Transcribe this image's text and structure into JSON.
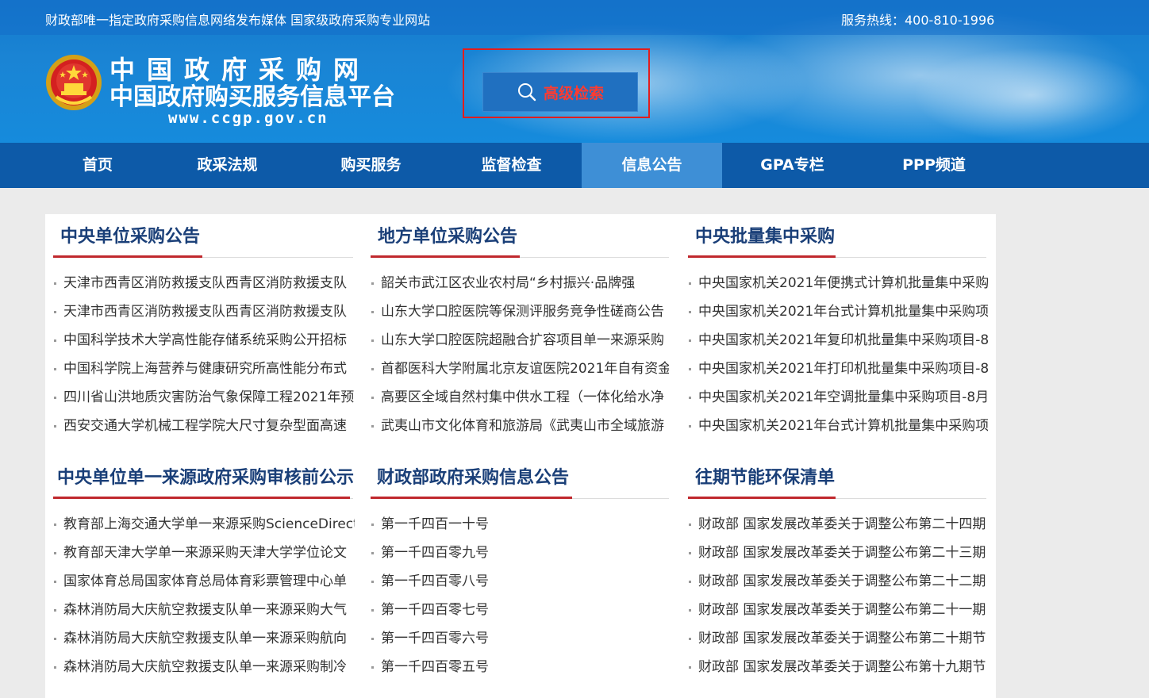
{
  "header": {
    "slogan": "财政部唯一指定政府采购信息网络发布媒体 国家级政府采购专业网站",
    "hotline": "服务热线：400-810-1996",
    "logo_line1": "中国政府采购网",
    "logo_line2": "中国政府购买服务信息平台",
    "logo_url": "www.ccgp.gov.cn",
    "search_label": "高级检索",
    "search_icon": "search-icon",
    "emblem_icon": "national-emblem-icon"
  },
  "nav": {
    "items": [
      "首页",
      "政采法规",
      "购买服务",
      "监督检查",
      "信息公告",
      "GPA专栏",
      "PPP频道"
    ],
    "active": "信息公告"
  },
  "colors": {
    "header_blue": "#1a84d4",
    "nav_blue": "#0d5aa8",
    "nav_active": "#3e8fd6",
    "title_navy": "#1a3f78",
    "accent_red": "#c0282d",
    "search_red": "#ff3b30"
  },
  "sections": [
    {
      "title": "中央单位采购公告",
      "items": [
        "天津市西青区消防救援支队西青区消防救援支队",
        "天津市西青区消防救援支队西青区消防救援支队",
        "中国科学技术大学高性能存储系统采购公开招标",
        "中国科学院上海营养与健康研究所高性能分布式",
        "四川省山洪地质灾害防治气象保障工程2021年预",
        "西安交通大学机械工程学院大尺寸复杂型面高速"
      ]
    },
    {
      "title": "地方单位采购公告",
      "items": [
        "韶关市武江区农业农村局“乡村振兴·品牌强",
        "山东大学口腔医院等保测评服务竞争性磋商公告",
        "山东大学口腔医院超融合扩容项目单一来源采购",
        "首都医科大学附属北京友谊医院2021年自有资金",
        "高要区全域自然村集中供水工程（一体化给水净",
        "武夷山市文化体育和旅游局《武夷山市全域旅游"
      ]
    },
    {
      "title": "中央批量集中采购",
      "items": [
        "中央国家机关2021年便携式计算机批量集中采购",
        "中央国家机关2021年台式计算机批量集中采购项",
        "中央国家机关2021年复印机批量集中采购项目-8",
        "中央国家机关2021年打印机批量集中采购项目-8",
        "中央国家机关2021年空调批量集中采购项目-8月",
        "中央国家机关2021年台式计算机批量集中采购项"
      ]
    },
    {
      "title": "中央单位单一来源政府采购审核前公示",
      "items": [
        "教育部上海交通大学单一来源采购ScienceDirect",
        "教育部天津大学单一来源采购天津大学学位论文",
        "国家体育总局国家体育总局体育彩票管理中心单",
        "森林消防局大庆航空救援支队单一来源采购大气",
        "森林消防局大庆航空救援支队单一来源采购航向",
        "森林消防局大庆航空救援支队单一来源采购制冷"
      ]
    },
    {
      "title": "财政部政府采购信息公告",
      "items": [
        "第一千四百一十号",
        "第一千四百零九号",
        "第一千四百零八号",
        "第一千四百零七号",
        "第一千四百零六号",
        "第一千四百零五号"
      ]
    },
    {
      "title": "往期节能环保清单",
      "items": [
        "财政部 国家发展改革委关于调整公布第二十四期",
        "财政部 国家发展改革委关于调整公布第二十三期",
        "财政部 国家发展改革委关于调整公布第二十二期",
        "财政部 国家发展改革委关于调整公布第二十一期",
        "财政部 国家发展改革委关于调整公布第二十期节",
        "财政部 国家发展改革委关于调整公布第十九期节"
      ]
    }
  ]
}
